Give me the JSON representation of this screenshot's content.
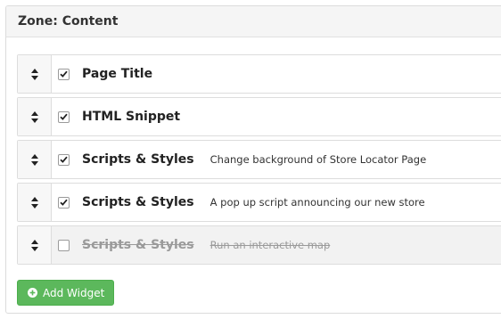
{
  "zone": {
    "title": "Zone: Content"
  },
  "widgets": [
    {
      "name": "Page Title",
      "description": "",
      "checked": true,
      "enabled": true
    },
    {
      "name": "HTML Snippet",
      "description": "",
      "checked": true,
      "enabled": true
    },
    {
      "name": "Scripts & Styles",
      "description": "Change background of Store Locator Page",
      "checked": true,
      "enabled": true
    },
    {
      "name": "Scripts & Styles",
      "description": "A pop up script announcing our new store",
      "checked": true,
      "enabled": true
    },
    {
      "name": "Scripts & Styles",
      "description": "Run an interactive map",
      "checked": false,
      "enabled": false
    }
  ],
  "actions": {
    "add_widget_label": "Add Widget"
  },
  "icons": {
    "drag": "drag-handle-icon",
    "checkbox": "checkmark-icon",
    "add": "plus-circle-icon"
  },
  "colors": {
    "accent_green": "#5cb85c",
    "header_bg": "#f5f5f5",
    "disabled_row_bg": "#f2f2f2",
    "disabled_text": "#9a9a9a"
  }
}
